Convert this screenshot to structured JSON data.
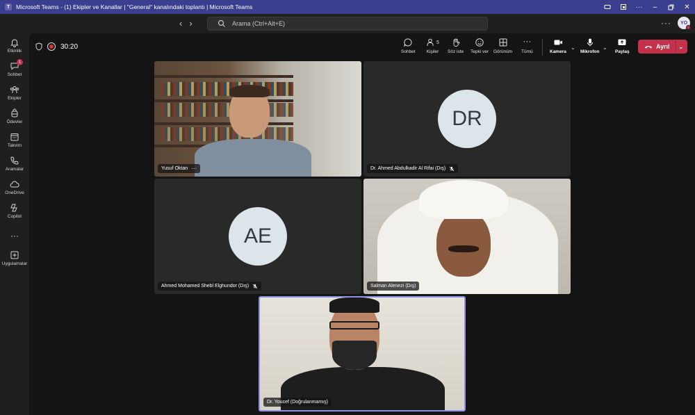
{
  "window": {
    "title": "Microsoft Teams - (1) Ekipler ve Kanallar | \"General\" kanalındaki toplantı | Microsoft Teams"
  },
  "header": {
    "search_placeholder": "Arama (Ctrl+Alt+E)",
    "avatar_initials": "YO"
  },
  "rail": {
    "items": [
      {
        "label": "Etkinlik",
        "icon": "bell-icon"
      },
      {
        "label": "Sohbet",
        "icon": "chat-icon",
        "badge": "1"
      },
      {
        "label": "Ekipler",
        "icon": "teams-icon"
      },
      {
        "label": "Ödevler",
        "icon": "backpack-icon"
      },
      {
        "label": "Takvim",
        "icon": "calendar-icon"
      },
      {
        "label": "Aramalar",
        "icon": "phone-icon"
      },
      {
        "label": "OneDrive",
        "icon": "cloud-icon"
      },
      {
        "label": "Copilot",
        "icon": "copilot-icon"
      },
      {
        "label": "",
        "icon": "more-icon"
      },
      {
        "label": "Uygulamalar",
        "icon": "add-app-icon"
      }
    ]
  },
  "toolbar": {
    "timer": "30:20",
    "chat": "Sohbet",
    "people": "Kişiler",
    "people_count": "5",
    "raise_hand": "Söz iste",
    "react": "Tepki ver",
    "view": "Görünüm",
    "more": "Tümü",
    "camera": "Kamera",
    "mic": "Mikrofon",
    "share": "Paylaş",
    "leave": "Ayrıl"
  },
  "participants": [
    {
      "name": "Yusuf Oktan",
      "type": "video"
    },
    {
      "name": "Dr. Ahmed Abdulkadir Al Rifai (Dış)",
      "type": "avatar",
      "initials": "DR",
      "muted": true
    },
    {
      "name": "Ahmed Mohamed Shebl Elghundor (Dış)",
      "type": "avatar",
      "initials": "AE",
      "muted": true
    },
    {
      "name": "Salman Alenezi (Dış)",
      "type": "video"
    },
    {
      "name": "Dr. Youcef (Doğrulanmamış)",
      "type": "video",
      "active": true
    }
  ],
  "colors": {
    "titlebar": "#3b3d8f",
    "leave_button": "#c4314b",
    "active_speaker": "#8e90e6",
    "background": "#1f1f1f"
  }
}
